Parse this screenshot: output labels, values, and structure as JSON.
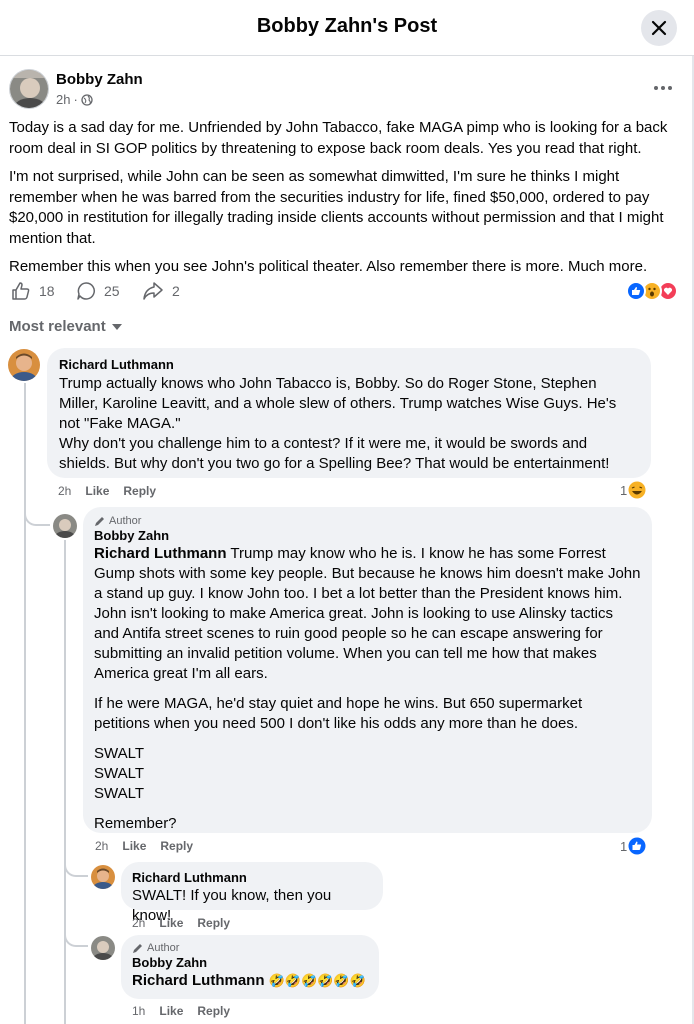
{
  "modal": {
    "title": "Bobby Zahn's Post"
  },
  "post": {
    "author": "Bobby Zahn",
    "time": "2h",
    "time_separator": "·",
    "paragraphs": [
      "Today is a sad day for me. Unfriended by John Tabacco, fake MAGA pimp who is looking for a back room deal in SI GOP politics by threatening to expose back room deals. Yes you read that right.",
      "I'm not surprised, while John can be seen as somewhat dimwitted, I'm sure he thinks I might remember when he was barred from the securities industry for life, fined $50,000, ordered to pay $20,000 in restitution for illegally trading inside clients accounts without permission and that I might mention that.",
      "Remember this when you see John's political theater. Also remember there is more. Much more."
    ],
    "likes": "18",
    "comments": "25",
    "shares": "2"
  },
  "filter": {
    "label": "Most relevant"
  },
  "comments": [
    {
      "author": "Richard Luthmann",
      "text_1": "Trump actually knows who John Tabacco is, Bobby. So do Roger Stone, Stephen Miller, Karoline Leavitt, and a whole slew of others. Trump watches Wise Guys. He's not \"Fake MAGA.\"",
      "text_2": "Why don't you challenge him to a contest? If it were me, it would be swords and shields. But why don't you two go for a Spelling Bee? That would be entertainment!",
      "time": "2h",
      "like": "Like",
      "reply": "Reply",
      "reaction_count": "1"
    },
    {
      "badge": "Author",
      "author": "Bobby Zahn",
      "mention": "Richard Luthmann",
      "text_1": " Trump may know who he is. I know he has some Forrest Gump shots with some key people. But because he knows him doesn't make John a stand up guy. I know John too. I bet a lot better than the President knows him. John isn't looking to make America great. John is looking to use Alinsky tactics and Antifa street scenes to ruin good people so he can escape answering for submitting an invalid petition volume. When you can tell me how that makes America great I'm all ears.",
      "text_2": "If he were MAGA, he'd stay quiet and hope he wins. But 650 supermarket petitions when you need 500 I don't like his odds any more than he does.",
      "swalt": [
        "SWALT",
        "SWALT",
        "SWALT"
      ],
      "text_3": "Remember?",
      "time": "2h",
      "like": "Like",
      "reply": "Reply",
      "reaction_count": "1"
    },
    {
      "author": "Richard Luthmann",
      "text_1": "SWALT! If you know, then you know!",
      "time": "2h",
      "like": "Like",
      "reply": "Reply"
    },
    {
      "badge": "Author",
      "author": "Bobby Zahn",
      "mention": "Richard Luthmann",
      "emoji": "🤣🤣🤣🤣🤣🤣",
      "time": "1h",
      "like": "Like",
      "reply": "Reply"
    }
  ],
  "colors": {
    "brand": "#0866ff",
    "muted": "#65676b",
    "bubble": "#f0f2f5",
    "love": "#f33e58",
    "haha": "#f7b125"
  }
}
